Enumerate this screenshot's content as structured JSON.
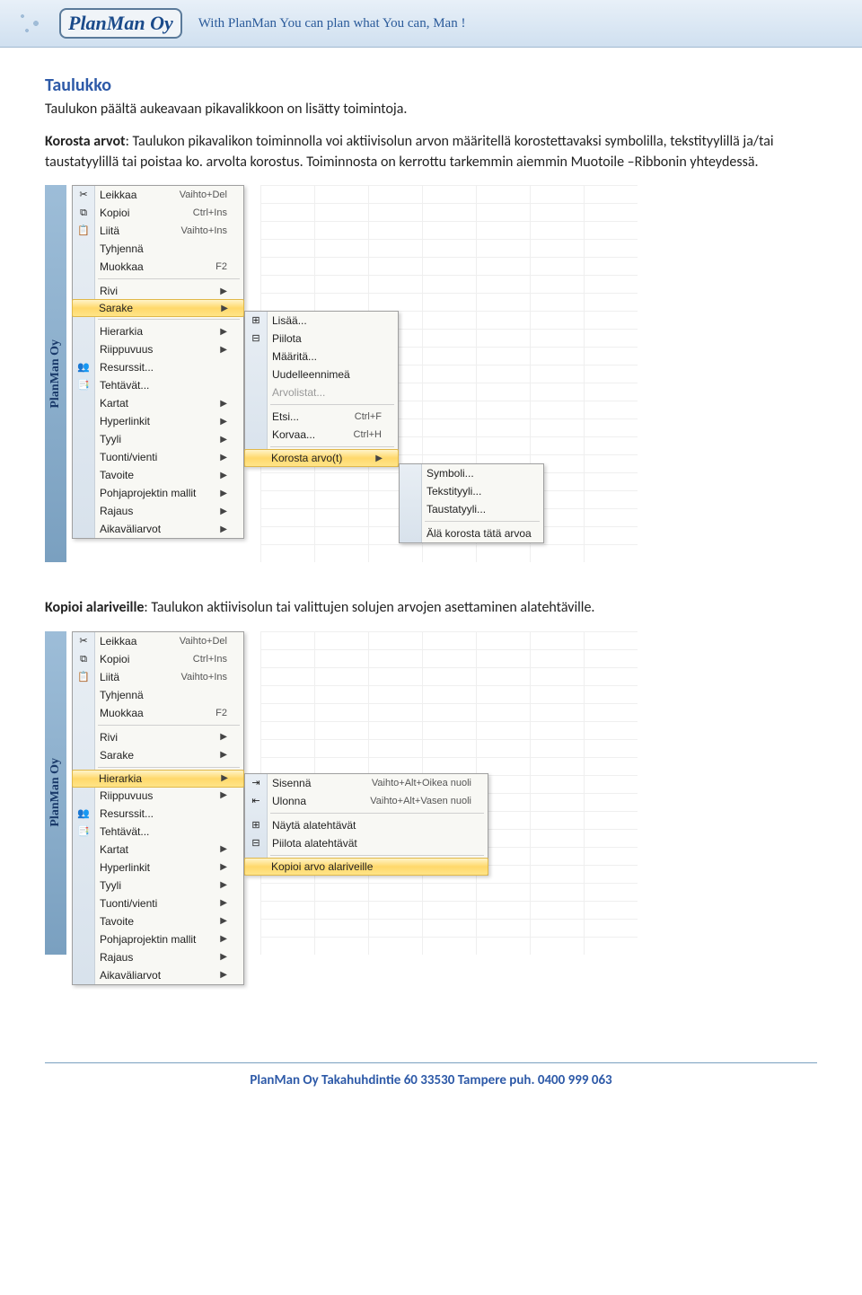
{
  "header": {
    "logo_text": "PlanMan Oy",
    "tagline": "With PlanMan You can plan what You can, Man !"
  },
  "section_title": "Taulukko",
  "intro_text": "Taulukon päältä aukeavaan pikavalikkoon on lisätty toimintoja.",
  "para1_bold": "Korosta arvot",
  "para1_rest": ": Taulukon pikavalikon toiminnolla voi aktiivisolun arvon määritellä korostettavaksi symbolilla, tekstityylillä ja/tai taustatyylillä tai poistaa ko. arvolta korostus. Toiminnosta on kerrottu tarkemmin aiemmin Muotoile –Ribbonin yhteydessä.",
  "vstrip": "PlanMan Oy",
  "menu1": {
    "items": [
      {
        "label": "Leikkaa",
        "shortcut": "Vaihto+Del",
        "icon": "✂"
      },
      {
        "label": "Kopioi",
        "shortcut": "Ctrl+Ins",
        "icon": "⧉"
      },
      {
        "label": "Liitä",
        "shortcut": "Vaihto+Ins",
        "icon": "📋"
      },
      {
        "label": "Tyhjennä"
      },
      {
        "label": "Muokkaa",
        "shortcut": "F2"
      },
      {
        "sep": true
      },
      {
        "label": "Rivi",
        "arrow": true
      },
      {
        "label": "Sarake",
        "arrow": true,
        "sel": true
      },
      {
        "sep": true
      },
      {
        "label": "Hierarkia",
        "arrow": true
      },
      {
        "label": "Riippuvuus",
        "arrow": true
      },
      {
        "label": "Resurssit...",
        "icon": "👥"
      },
      {
        "label": "Tehtävät...",
        "icon": "📑"
      },
      {
        "label": "Kartat",
        "arrow": true
      },
      {
        "label": "Hyperlinkit",
        "arrow": true
      },
      {
        "label": "Tyyli",
        "arrow": true
      },
      {
        "label": "Tuonti/vienti",
        "arrow": true
      },
      {
        "label": "Tavoite",
        "arrow": true
      },
      {
        "label": "Pohjaprojektin mallit",
        "arrow": true
      },
      {
        "label": "Rajaus",
        "arrow": true
      },
      {
        "label": "Aikaväliarvot",
        "arrow": true
      }
    ]
  },
  "submenu1": {
    "items": [
      {
        "label": "Lisää...",
        "icon": "⊞"
      },
      {
        "label": "Piilota",
        "icon": "⊟"
      },
      {
        "label": "Määritä..."
      },
      {
        "label": "Uudelleennimeä"
      },
      {
        "label": "Arvolistat...",
        "disabled": true
      },
      {
        "sep": true
      },
      {
        "label": "Etsi...",
        "shortcut": "Ctrl+F"
      },
      {
        "label": "Korvaa...",
        "shortcut": "Ctrl+H"
      },
      {
        "sep": true
      },
      {
        "label": "Korosta arvo(t)",
        "arrow": true,
        "sel": true
      }
    ]
  },
  "submenu1b": {
    "items": [
      {
        "label": "Symboli..."
      },
      {
        "label": "Tekstityyli..."
      },
      {
        "label": "Taustatyyli..."
      },
      {
        "sep": true
      },
      {
        "label": "Älä korosta tätä arvoa"
      }
    ]
  },
  "para2_bold": "Kopioi alariveille",
  "para2_rest": ": Taulukon aktiivisolun tai valittujen solujen arvojen asettaminen alatehtäville.",
  "menu2": {
    "items": [
      {
        "label": "Leikkaa",
        "shortcut": "Vaihto+Del",
        "icon": "✂"
      },
      {
        "label": "Kopioi",
        "shortcut": "Ctrl+Ins",
        "icon": "⧉"
      },
      {
        "label": "Liitä",
        "shortcut": "Vaihto+Ins",
        "icon": "📋"
      },
      {
        "label": "Tyhjennä"
      },
      {
        "label": "Muokkaa",
        "shortcut": "F2"
      },
      {
        "sep": true
      },
      {
        "label": "Rivi",
        "arrow": true
      },
      {
        "label": "Sarake",
        "arrow": true
      },
      {
        "sep": true
      },
      {
        "label": "Hierarkia",
        "arrow": true,
        "sel": true
      },
      {
        "label": "Riippuvuus",
        "arrow": true
      },
      {
        "label": "Resurssit...",
        "icon": "👥"
      },
      {
        "label": "Tehtävät...",
        "icon": "📑"
      },
      {
        "label": "Kartat",
        "arrow": true
      },
      {
        "label": "Hyperlinkit",
        "arrow": true
      },
      {
        "label": "Tyyli",
        "arrow": true
      },
      {
        "label": "Tuonti/vienti",
        "arrow": true
      },
      {
        "label": "Tavoite",
        "arrow": true
      },
      {
        "label": "Pohjaprojektin mallit",
        "arrow": true
      },
      {
        "label": "Rajaus",
        "arrow": true
      },
      {
        "label": "Aikaväliarvot",
        "arrow": true
      }
    ]
  },
  "submenu2": {
    "items": [
      {
        "label": "Sisennä",
        "shortcut": "Vaihto+Alt+Oikea nuoli",
        "icon": "⇥"
      },
      {
        "label": "Ulonna",
        "shortcut": "Vaihto+Alt+Vasen nuoli",
        "icon": "⇤"
      },
      {
        "sep": true
      },
      {
        "label": "Näytä alatehtävät",
        "icon": "⊞"
      },
      {
        "label": "Piilota alatehtävät",
        "icon": "⊟"
      },
      {
        "sep": true
      },
      {
        "label": "Kopioi arvo alariveille",
        "sel": true
      }
    ]
  },
  "footer": "PlanMan Oy   Takahuhdintie 60   33530 Tampere   puh. 0400 999 063"
}
